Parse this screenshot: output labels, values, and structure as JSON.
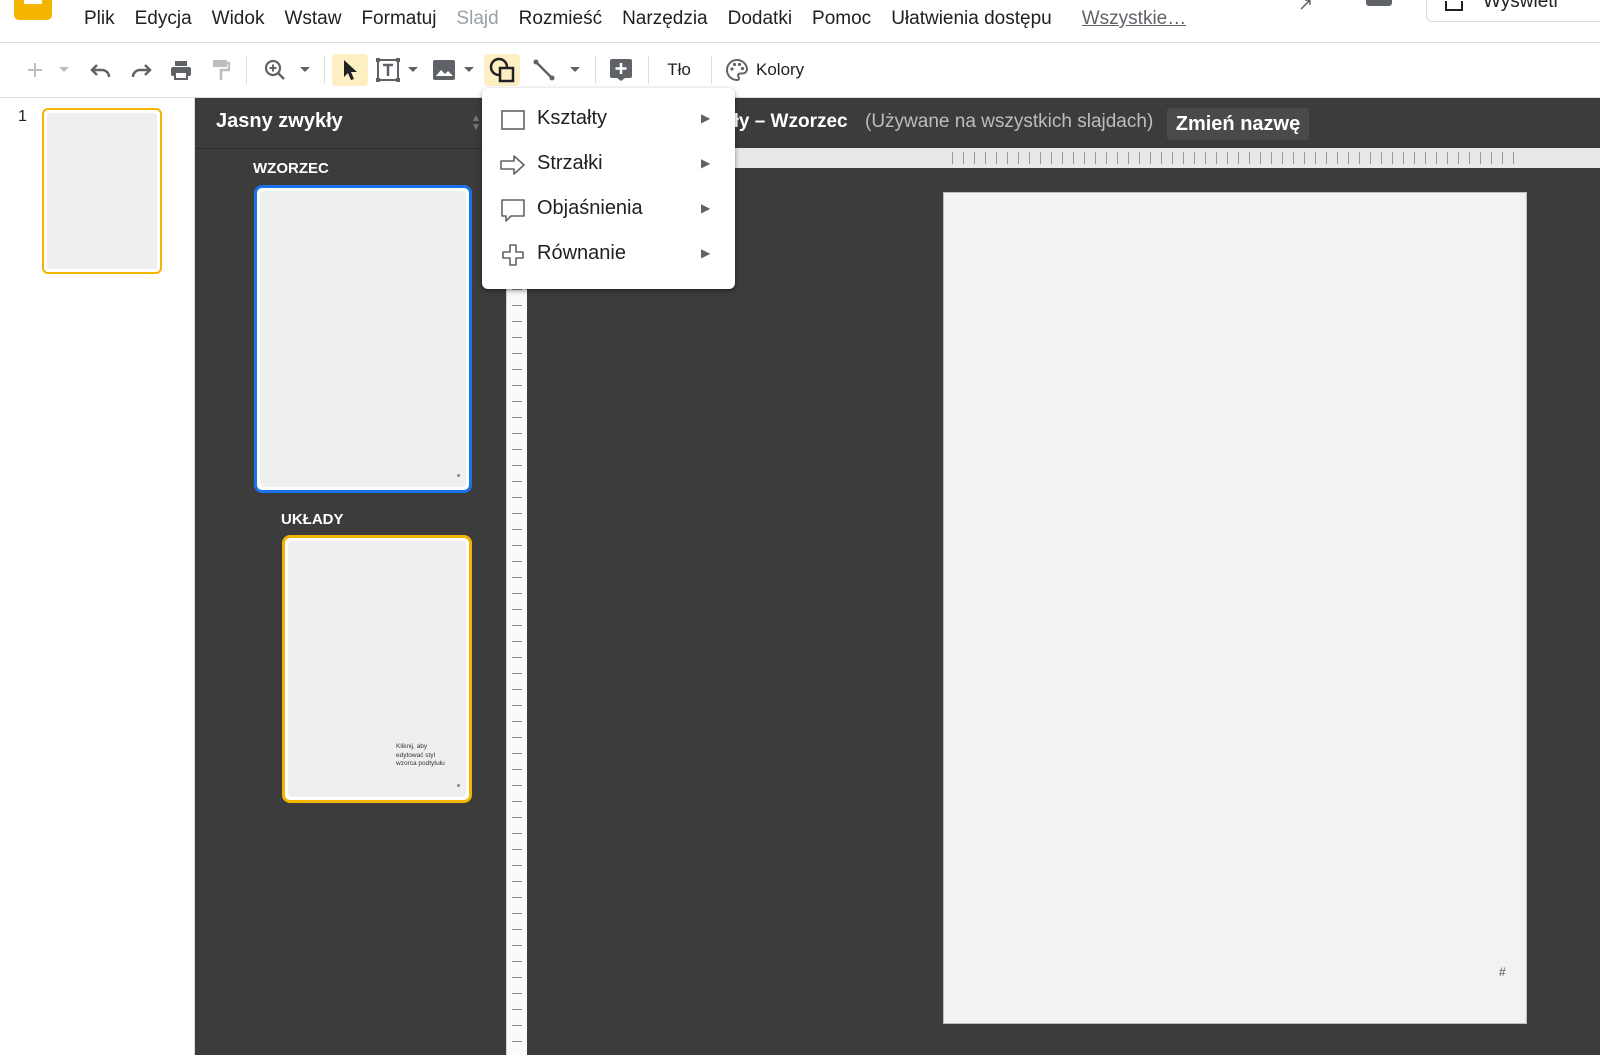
{
  "menubar": {
    "items": [
      "Plik",
      "Edycja",
      "Widok",
      "Wstaw",
      "Formatuj",
      "Slajd",
      "Rozmieść",
      "Narzędzia",
      "Dodatki",
      "Pomoc",
      "Ułatwienia dostępu"
    ],
    "all_link": "Wszystkie…",
    "present_label": "Wyświetl"
  },
  "toolbar": {
    "background_label": "Tło",
    "colors_label": "Kolory",
    "active_tool": "shape-tool"
  },
  "filmstrip": {
    "slide_number": "1"
  },
  "master_panel": {
    "theme_name": "Jasny zwykły",
    "master_label": "WZORZEC",
    "layouts_label": "UKŁADY",
    "layout_subtitle_placeholder": "Kliknij, aby edytować styl wzorca podtytułu"
  },
  "canvas": {
    "layout_title": "kły – Wzorzec",
    "usage_note": "(Używane na wszystkich slajdach)",
    "rename_button": "Zmień nazwę",
    "slide_number_placeholder": "#"
  },
  "shape_menu": {
    "items": [
      {
        "label": "Kształty",
        "icon": "rectangle-icon"
      },
      {
        "label": "Strzałki",
        "icon": "arrow-icon"
      },
      {
        "label": "Objaśnienia",
        "icon": "callout-icon"
      },
      {
        "label": "Równanie",
        "icon": "plus-icon"
      }
    ]
  },
  "colors": {
    "accent_yellow": "#f4b400",
    "selection_blue": "#1a73e8",
    "dark_panel": "#3c3c3c"
  }
}
